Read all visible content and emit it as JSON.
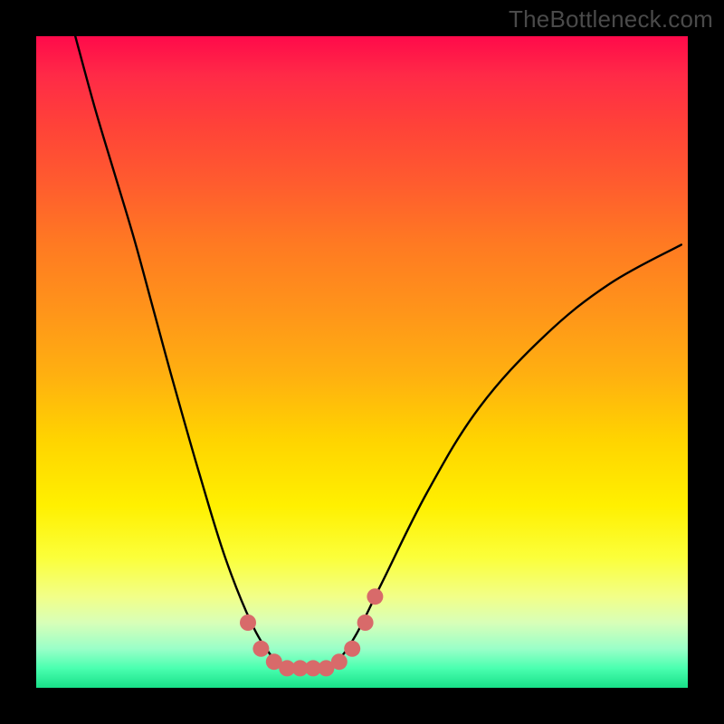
{
  "watermark": "TheBottleneck.com",
  "chart_data": {
    "type": "line",
    "title": "",
    "xlabel": "",
    "ylabel": "",
    "xlim": [
      0,
      1
    ],
    "ylim": [
      0,
      1
    ],
    "grid": false,
    "background_gradient": [
      "#ff0a4a",
      "#ff7a22",
      "#ffd400",
      "#fbff3a",
      "#18e088"
    ],
    "series": [
      {
        "name": "curve",
        "color": "#000000",
        "x": [
          0.06,
          0.09,
          0.12,
          0.15,
          0.18,
          0.21,
          0.25,
          0.29,
          0.33,
          0.36,
          0.38,
          0.4,
          0.43,
          0.46,
          0.49,
          0.53,
          0.6,
          0.68,
          0.78,
          0.88,
          0.99
        ],
        "y": [
          1.0,
          0.89,
          0.79,
          0.69,
          0.58,
          0.47,
          0.33,
          0.2,
          0.1,
          0.05,
          0.03,
          0.03,
          0.03,
          0.04,
          0.08,
          0.16,
          0.3,
          0.43,
          0.54,
          0.62,
          0.68
        ]
      },
      {
        "name": "highlight-dots",
        "color": "#d86a6a",
        "x": [
          0.325,
          0.345,
          0.365,
          0.385,
          0.405,
          0.425,
          0.445,
          0.465,
          0.485,
          0.505,
          0.52
        ],
        "y": [
          0.1,
          0.06,
          0.04,
          0.03,
          0.03,
          0.03,
          0.03,
          0.04,
          0.06,
          0.1,
          0.14
        ]
      }
    ]
  }
}
